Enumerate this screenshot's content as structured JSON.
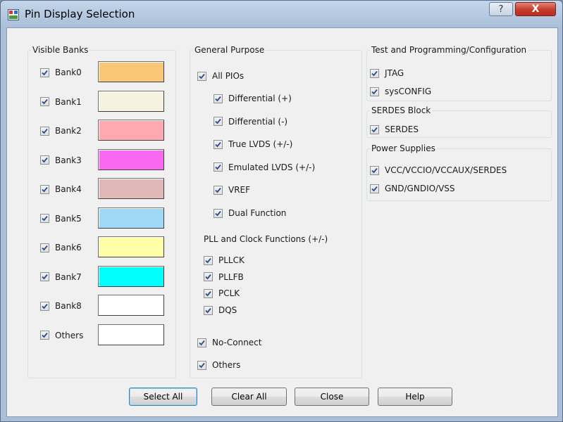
{
  "window": {
    "title": "Pin Display Selection",
    "help_glyph": "?",
    "close_glyph": "X"
  },
  "visible_banks": {
    "legend": "Visible Banks",
    "items": [
      {
        "label": "Bank0",
        "checked": true,
        "color": "#F8C878"
      },
      {
        "label": "Bank1",
        "checked": true,
        "color": "#F5F2E0"
      },
      {
        "label": "Bank2",
        "checked": true,
        "color": "#FFA8B0"
      },
      {
        "label": "Bank3",
        "checked": true,
        "color": "#F868F0"
      },
      {
        "label": "Bank4",
        "checked": true,
        "color": "#E0B8B8"
      },
      {
        "label": "Bank5",
        "checked": true,
        "color": "#A0D8F8"
      },
      {
        "label": "Bank6",
        "checked": true,
        "color": "#FFFFA8"
      },
      {
        "label": "Bank7",
        "checked": true,
        "color": "#00FFFF"
      },
      {
        "label": "Bank8",
        "checked": true,
        "color": "#FFFFFF"
      },
      {
        "label": "Others",
        "checked": true,
        "color": "#FFFFFF"
      }
    ]
  },
  "general_purpose": {
    "legend": "General Purpose",
    "all_pios": {
      "label": "All PIOs",
      "checked": true
    },
    "pio_items": [
      {
        "label": "Differential (+)",
        "checked": true
      },
      {
        "label": "Differential (-)",
        "checked": true
      },
      {
        "label": "True LVDS (+/-)",
        "checked": true
      },
      {
        "label": "Emulated LVDS (+/-)",
        "checked": true
      },
      {
        "label": "VREF",
        "checked": true
      },
      {
        "label": "Dual Function",
        "checked": true
      }
    ],
    "pll_heading": "PLL and Clock Functions (+/-)",
    "pll_items": [
      {
        "label": "PLLCK",
        "checked": true
      },
      {
        "label": "PLLFB",
        "checked": true
      },
      {
        "label": "PCLK",
        "checked": true
      },
      {
        "label": "DQS",
        "checked": true
      }
    ],
    "no_connect": {
      "label": "No-Connect",
      "checked": true
    },
    "others": {
      "label": "Others",
      "checked": true
    }
  },
  "test_programming": {
    "legend": "Test and Programming/Configuration",
    "items": [
      {
        "label": "JTAG",
        "checked": true
      },
      {
        "label": "sysCONFIG",
        "checked": true
      }
    ]
  },
  "serdes_block": {
    "legend": "SERDES Block",
    "items": [
      {
        "label": "SERDES",
        "checked": true
      }
    ]
  },
  "power_supplies": {
    "legend": "Power Supplies",
    "items": [
      {
        "label": "VCC/VCCIO/VCCAUX/SERDES",
        "checked": true
      },
      {
        "label": "GND/GNDIO/VSS",
        "checked": true
      }
    ]
  },
  "buttons": {
    "select_all": "Select All",
    "clear_all": "Clear All",
    "close": "Close",
    "help": "Help"
  }
}
